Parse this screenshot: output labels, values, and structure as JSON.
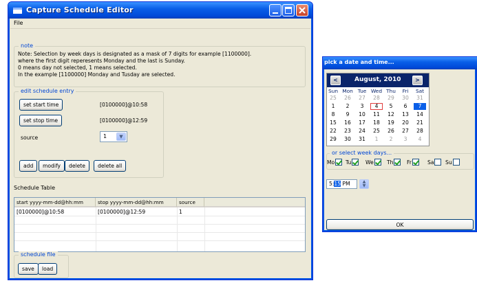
{
  "main_window": {
    "title": "Capture Schedule Editor",
    "menu_file": "File",
    "note": {
      "legend": "note",
      "lines": [
        "Note: Selection by week days is designated as a mask of 7 digits for example [1100000].",
        "where the first digit reperesents Monday and the last is Sunday.",
        "0 means day not selected, 1 means selected.",
        "In the example [1100000] Monday and Tusday are selected."
      ]
    },
    "edit": {
      "legend": "edit schedule entry",
      "start_button": "set start time",
      "start_value": "[0100000]@10:58",
      "stop_button": "set stop time",
      "stop_value": "[0100000]@12:59",
      "source_label": "source",
      "source_value": "1",
      "add": "add",
      "modify": "modify",
      "delete": "delete",
      "delete_all": "delete all"
    },
    "table": {
      "title": "Schedule Table",
      "columns": [
        "start yyyy-mm-dd@hh:mm",
        "stop yyyy-mm-dd@hh:mm",
        "source"
      ],
      "rows": [
        [
          "[0100000]@10:58",
          "[0100000]@12:59",
          "1"
        ]
      ]
    },
    "file": {
      "legend": "schedule file",
      "save": "save",
      "load": "load"
    }
  },
  "picker": {
    "title": "pick a date and time...",
    "month": "August, 2010",
    "prev": "<",
    "next": ">",
    "dow": [
      "Sun",
      "Mon",
      "Tue",
      "Wed",
      "Thu",
      "Fri",
      "Sat"
    ],
    "weeks": [
      [
        "25",
        "26",
        "27",
        "28",
        "29",
        "30",
        "31"
      ],
      [
        "1",
        "2",
        "3",
        "4",
        "5",
        "6",
        "7"
      ],
      [
        "8",
        "9",
        "10",
        "11",
        "12",
        "13",
        "14"
      ],
      [
        "15",
        "16",
        "17",
        "18",
        "19",
        "20",
        "21"
      ],
      [
        "22",
        "23",
        "24",
        "25",
        "26",
        "27",
        "28"
      ],
      [
        "29",
        "30",
        "31",
        "1",
        "2",
        "3",
        "4"
      ]
    ],
    "today": "4",
    "selected": "7",
    "weekdays_legend": "or select week days...",
    "weekdays": [
      {
        "label": "Mo",
        "checked": true
      },
      {
        "label": "Tu",
        "checked": true
      },
      {
        "label": "We",
        "checked": true
      },
      {
        "label": "Th",
        "checked": true
      },
      {
        "label": "Fr",
        "checked": true
      },
      {
        "label": "Sa",
        "checked": false
      },
      {
        "label": "Su",
        "checked": false
      }
    ],
    "time_hour": "5",
    "time_sep": ":",
    "time_minute": "15",
    "time_ampm": "PM",
    "ok": "OK"
  }
}
